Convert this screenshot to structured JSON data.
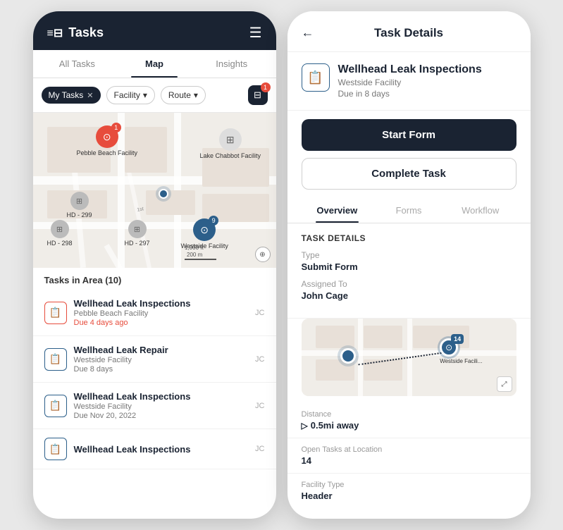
{
  "left_phone": {
    "header": {
      "title": "Tasks",
      "menu_icon": "☰"
    },
    "tabs": [
      {
        "label": "All Tasks",
        "active": false
      },
      {
        "label": "Map",
        "active": true
      },
      {
        "label": "Insights",
        "active": false
      }
    ],
    "filters": {
      "my_tasks_label": "My Tasks",
      "facility_label": "Facility",
      "route_label": "Route",
      "filter_count": "1"
    },
    "map": {
      "scale_label": "1,000 ft\n200 m"
    },
    "tasks_section": {
      "header": "Tasks in Area (10)"
    },
    "tasks": [
      {
        "title": "Wellhead Leak Inspections",
        "facility": "Pebble Beach Facility",
        "due": "Due 4 days ago",
        "due_overdue": true,
        "assignee": "JC",
        "icon_type": "red"
      },
      {
        "title": "Wellhead Leak Repair",
        "facility": "Westside Facility",
        "due": "Due 8 days",
        "due_overdue": false,
        "assignee": "JC",
        "icon_type": "blue"
      },
      {
        "title": "Wellhead Leak Inspections",
        "facility": "Westside Facility",
        "due": "Due Nov 20, 2022",
        "due_overdue": false,
        "assignee": "JC",
        "icon_type": "blue"
      },
      {
        "title": "Wellhead Leak Inspections",
        "facility": "",
        "due": "",
        "due_overdue": false,
        "assignee": "JC",
        "icon_type": "blue"
      }
    ],
    "map_pins": [
      {
        "id": "pebble-beach",
        "label": "Pebble Beach Facility",
        "badge": "1",
        "badge_color": "red"
      },
      {
        "id": "lake-chabbot",
        "label": "Lake Chabbot Facility",
        "badge": null
      },
      {
        "id": "westside",
        "label": "Westside Facility",
        "badge": "9",
        "badge_color": "blue"
      },
      {
        "id": "hd299",
        "label": "HD - 299",
        "badge": null
      },
      {
        "id": "hd298",
        "label": "HD - 298",
        "badge": null
      },
      {
        "id": "hd297",
        "label": "HD - 297",
        "badge": null
      }
    ]
  },
  "right_phone": {
    "header": {
      "title": "Task Details",
      "back_icon": "←",
      "menu_icon": "☰"
    },
    "task": {
      "title": "Wellhead Leak Inspections",
      "facility": "Westside Facility",
      "due": "Due in 8 days"
    },
    "buttons": {
      "start_form": "Start Form",
      "complete_task": "Complete Task"
    },
    "tabs": [
      {
        "label": "Overview",
        "active": true
      },
      {
        "label": "Forms",
        "active": false
      },
      {
        "label": "Workflow",
        "active": false
      }
    ],
    "task_details_section": {
      "title": "Task Details",
      "type_label": "Type",
      "type_value": "Submit Form",
      "assigned_label": "Assigned To",
      "assigned_value": "John Cage"
    },
    "mini_map": {
      "badge_count": "14",
      "pin_label": "Westside Facili...",
      "expand_icon": "⤢"
    },
    "distance": {
      "label": "Distance",
      "value": "0.5mi away",
      "icon": "▷"
    },
    "open_tasks": {
      "label": "Open Tasks at Location",
      "value": "14"
    },
    "facility_type": {
      "label": "Facility Type",
      "value": "Header"
    }
  }
}
